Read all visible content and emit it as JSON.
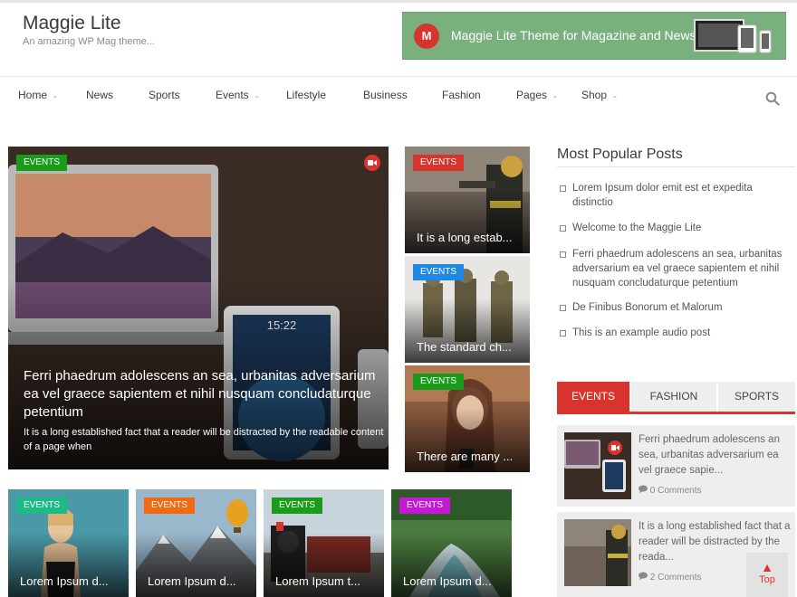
{
  "site": {
    "title": "Maggie Lite",
    "tagline": "An amazing WP Mag theme..."
  },
  "banner": {
    "logo_letter": "M",
    "text": "Maggie Lite Theme for Magazine and News"
  },
  "nav": {
    "items": [
      {
        "label": "Home",
        "has_caret": true
      },
      {
        "label": "News",
        "has_caret": false
      },
      {
        "label": "Sports",
        "has_caret": false
      },
      {
        "label": "Events",
        "has_caret": true
      },
      {
        "label": "Lifestyle",
        "has_caret": false
      },
      {
        "label": "Business",
        "has_caret": false
      },
      {
        "label": "Fashion",
        "has_caret": false
      },
      {
        "label": "Pages",
        "has_caret": true
      },
      {
        "label": "Shop",
        "has_caret": true
      }
    ],
    "caret_glyph": "⌄",
    "search_icon": "search-icon"
  },
  "featured": {
    "main": {
      "tag": "EVENTS",
      "tag_color": "#1a9b1a",
      "title": "Ferri phaedrum adolescens an sea, urbanitas adversarium ea vel graece sapientem et nihil nusquam concludaturque petentium",
      "excerpt": "It is a long established fact that a reader will be distracted by the readable content of a page when",
      "has_video": true
    },
    "side": [
      {
        "tag": "EVENTS",
        "tag_color": "#d8342e",
        "title": "It is a long estab..."
      },
      {
        "tag": "EVENTS",
        "tag_color": "#1e88e5",
        "title": "The standard ch..."
      },
      {
        "tag": "EVENTS",
        "tag_color": "#1a9b1a",
        "title": "There are many ..."
      }
    ]
  },
  "bottom": [
    {
      "tag": "EVENTS",
      "tag_color": "#1cba85",
      "title": "Lorem Ipsum d..."
    },
    {
      "tag": "EVENTS",
      "tag_color": "#f06a12",
      "title": "Lorem Ipsum d..."
    },
    {
      "tag": "EVENTS",
      "tag_color": "#1a9b1a",
      "title": "Lorem Ipsum t..."
    },
    {
      "tag": "EVENTS",
      "tag_color": "#c418d4",
      "title": "Lorem Ipsum d..."
    }
  ],
  "sidebar": {
    "popular_title": "Most Popular Posts",
    "popular": [
      "Lorem Ipsum dolor emit est et expedita distinctio",
      "Welcome to the Maggie Lite",
      "Ferri phaedrum adolescens an sea, urbanitas adversarium ea vel graece sapientem et nihil nusquam concludaturque petentium",
      "De Finibus Bonorum et Malorum",
      "This is an example audio post"
    ],
    "tabs": [
      "EVENTS",
      "FASHION",
      "SPORTS"
    ],
    "active_tab": "EVENTS",
    "tab_posts": [
      {
        "text": "Ferri phaedrum adolescens an sea, urbanitas adversarium ea vel graece sapie...",
        "comments": "0 Comments",
        "has_video": true
      },
      {
        "text": "It is a long established fact that a reader will be distracted by the reada...",
        "comments": "2 Comments",
        "has_video": false
      }
    ]
  },
  "back_to_top": {
    "label": "Top"
  },
  "colors": {
    "accent": "#d8342e",
    "banner_bg": "#7ab07d"
  }
}
